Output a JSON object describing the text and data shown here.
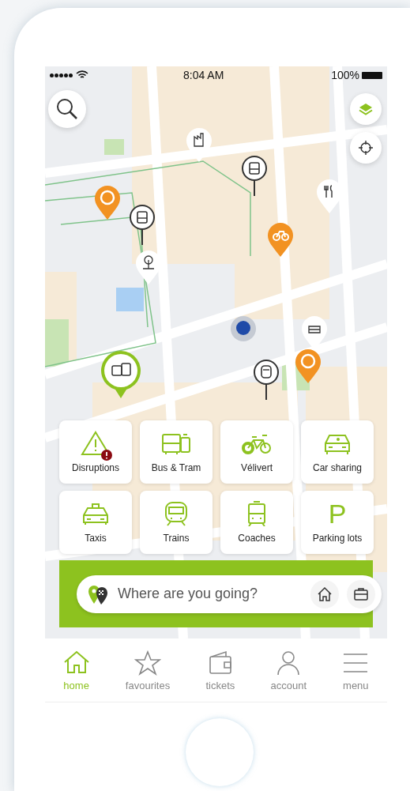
{
  "status_bar": {
    "time": "8:04 AM",
    "battery": "100%"
  },
  "categories": [
    {
      "label": "Disruptions",
      "alert": true
    },
    {
      "label": "Bus & Tram",
      "alert": false
    },
    {
      "label": "Vélivert",
      "alert": false
    },
    {
      "label": "Car sharing",
      "alert": false
    },
    {
      "label": "Taxis",
      "alert": false
    },
    {
      "label": "Trains",
      "alert": false
    },
    {
      "label": "Coaches",
      "alert": false
    },
    {
      "label": "Parking lots",
      "alert": false,
      "glyph": "P"
    }
  ],
  "search": {
    "placeholder": "Where are you going?"
  },
  "nav": [
    {
      "label": "home",
      "selected": true
    },
    {
      "label": "favourites",
      "selected": false
    },
    {
      "label": "tickets",
      "selected": false
    },
    {
      "label": "account",
      "selected": false
    },
    {
      "label": "menu",
      "selected": false
    }
  ]
}
